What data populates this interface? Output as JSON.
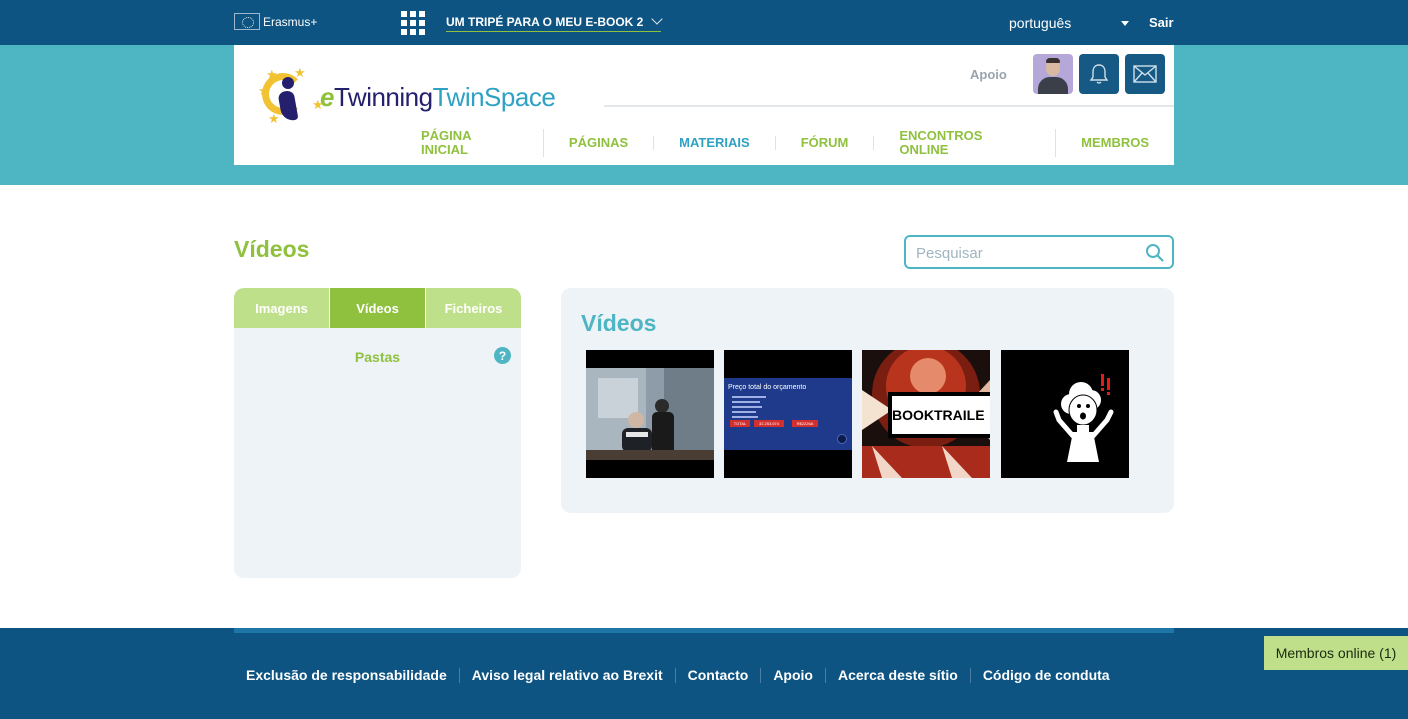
{
  "topbar": {
    "erasmus_label": "Erasmus+",
    "space_title": "UM TRIPÉ PARA O MEU E-BOOK 2",
    "language": "português",
    "logout": "Sair"
  },
  "header": {
    "logo_e": "e",
    "logo_twinning": "Twinning",
    "logo_twinspace": "TwinSpace",
    "support": "Apoio",
    "nav": [
      "PÁGINA INICIAL",
      "PÁGINAS",
      "MATERIAIS",
      "FÓRUM",
      "ENCONTROS ONLINE",
      "MEMBROS"
    ]
  },
  "page": {
    "title": "Vídeos",
    "search_placeholder": "Pesquisar"
  },
  "left_panel": {
    "tabs": [
      "Imagens",
      "Vídeos",
      "Ficheiros"
    ],
    "active_tab": "Vídeos",
    "folders_label": "Pastas",
    "help": "?"
  },
  "right_panel": {
    "title": "Vídeos",
    "videos": [
      {
        "caption": ""
      },
      {
        "caption": "Preço total do orçamento",
        "total_label": "TOTAL",
        "total_value": "32.253,674",
        "total_value2": "R$2226A"
      },
      {
        "caption": "BOOKTRAILE"
      },
      {
        "caption": ""
      }
    ]
  },
  "footer": {
    "links": [
      "Exclusão de responsabilidade",
      "Aviso legal relativo ao Brexit",
      "Contacto",
      "Apoio",
      "Acerca deste sítio",
      "Código de conduta"
    ],
    "online_members": "Membros online (1)"
  },
  "colors": {
    "topbar": "#0d5482",
    "band": "#4eb5c3",
    "accent_green": "#8fc13e",
    "accent_teal": "#4eb5c3"
  }
}
